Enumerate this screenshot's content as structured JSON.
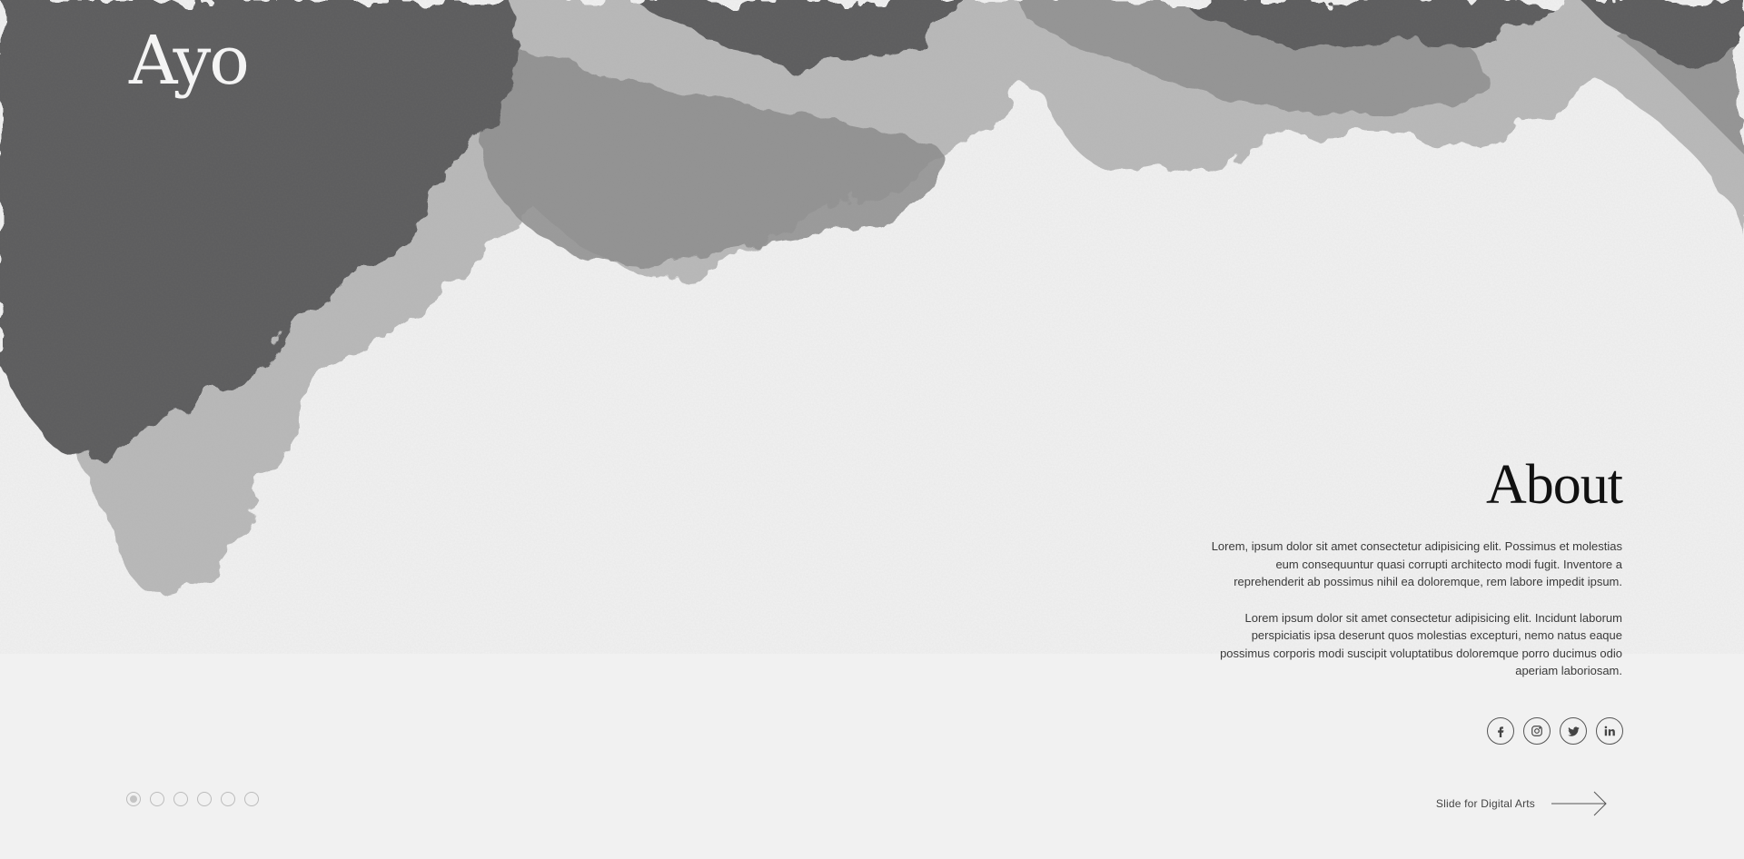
{
  "brand": {
    "logo": "Ayo"
  },
  "about": {
    "title": "About",
    "paragraphs": [
      "Lorem, ipsum dolor sit amet consectetur adipisicing elit. Possimus et molestias eum consequuntur quasi corrupti architecto modi fugit. Inventore a reprehenderit ab possimus nihil ea doloremque, rem labore impedit ipsum.",
      "Lorem ipsum dolor sit amet consectetur adipisicing elit. Incidunt laborum perspiciatis ipsa deserunt quos molestias excepturi, nemo natus eaque possimus corporis modi suscipit voluptatibus doloremque porro ducimus odio aperiam laboriosam."
    ]
  },
  "socials": [
    {
      "icon": "facebook-icon"
    },
    {
      "icon": "instagram-icon"
    },
    {
      "icon": "twitter-icon"
    },
    {
      "icon": "linkedin-icon"
    }
  ],
  "pagination": {
    "count": 6,
    "active_index": 0
  },
  "slide_next": {
    "label": "Slide for Digital Arts",
    "icon": "arrow-right-icon"
  },
  "colors": {
    "background": "#f1f1f1",
    "ink_dark": "#5b5b5d",
    "ink_light": "#b5b5b5"
  }
}
